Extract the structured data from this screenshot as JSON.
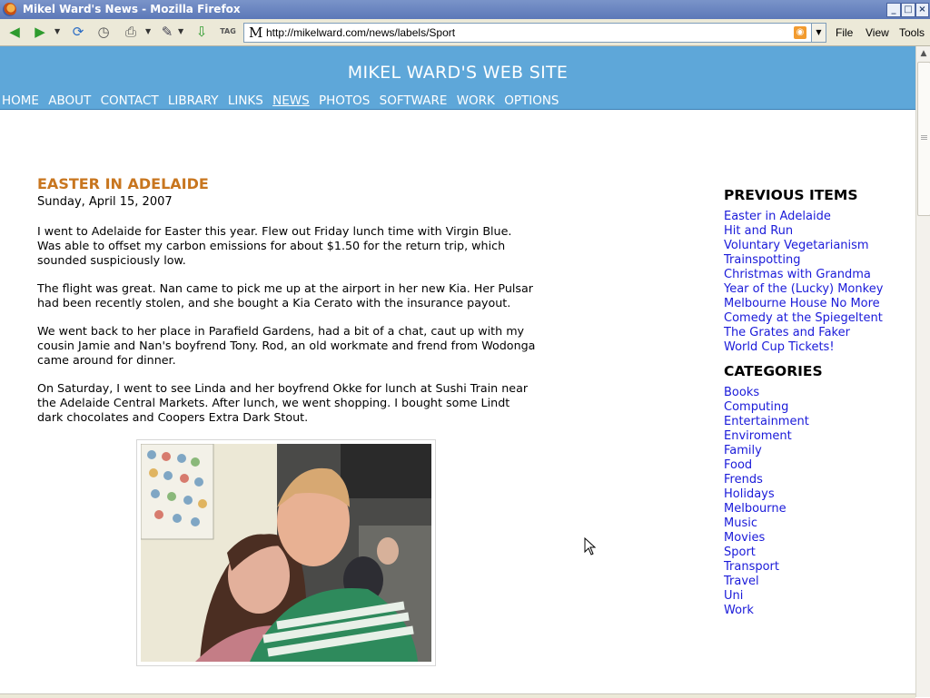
{
  "window": {
    "title": "Mikel Ward's News - Mozilla Firefox",
    "buttons": [
      "_",
      "□",
      "×"
    ]
  },
  "toolbar": {
    "url": "http://mikelward.com/news/labels/Sport",
    "site_icon": "M",
    "menus": [
      {
        "label": "File",
        "key": "F"
      },
      {
        "label": "View",
        "key": "V"
      },
      {
        "label": "Tools",
        "key": "T"
      }
    ],
    "icons": [
      "back-icon",
      "forward-icon",
      "reload-icon",
      "history-icon",
      "print-icon",
      "edit-icon",
      "download-icon",
      "tag-icon",
      "rss-icon"
    ]
  },
  "site": {
    "title": "MIKEL WARD'S WEB SITE",
    "nav": [
      "HOME",
      "ABOUT",
      "CONTACT",
      "LIBRARY",
      "LINKS",
      "NEWS",
      "PHOTOS",
      "SOFTWARE",
      "WORK",
      "OPTIONS"
    ],
    "active_nav": "NEWS",
    "header_color": "#5ea7d9"
  },
  "post": {
    "title": "EASTER IN ADELAIDE",
    "date": "Sunday, April 15, 2007",
    "paragraphs": [
      "I went to Adelaide for Easter this year. Flew out Friday lunch time with Virgin Blue. Was able to offset my carbon emissions for about $1.50 for the return trip, which sounded suspiciously low.",
      "The flight was great. Nan came to pick me up at the airport in her new Kia. Her Pulsar had been recently stolen, and she bought a Kia Cerato with the insurance payout.",
      "We went back to her place in Parafield Gardens, had a bit of a chat, caut up with my cousin Jamie and Nan's boyfrend Tony. Rod, an old workmate and frend from Wodonga came around for dinner.",
      "On Saturday, I went to see Linda and her boyfrend Okke for lunch at Sushi Train near the Adelaide Central Markets. After lunch, we went shopping. I bought some Lindt dark chocolates and Coopers Extra Dark Stout."
    ],
    "title_color": "#c8761f"
  },
  "sidebar": {
    "previous_heading": "PREVIOUS ITEMS",
    "previous_items": [
      "Easter in Adelaide",
      "Hit and Run",
      "Voluntary Vegetarianism",
      "Trainspotting",
      "Christmas with Grandma",
      "Year of the (Lucky) Monkey",
      "Melbourne House No More",
      "Comedy at the Spiegeltent",
      "The Grates and Faker",
      "World Cup Tickets!"
    ],
    "categories_heading": "CATEGORIES",
    "categories": [
      "Books",
      "Computing",
      "Entertainment",
      "Enviroment",
      "Family",
      "Food",
      "Frends",
      "Holidays",
      "Melbourne",
      "Music",
      "Movies",
      "Sport",
      "Transport",
      "Travel",
      "Uni",
      "Work"
    ],
    "link_color": "#1a1ad9"
  }
}
